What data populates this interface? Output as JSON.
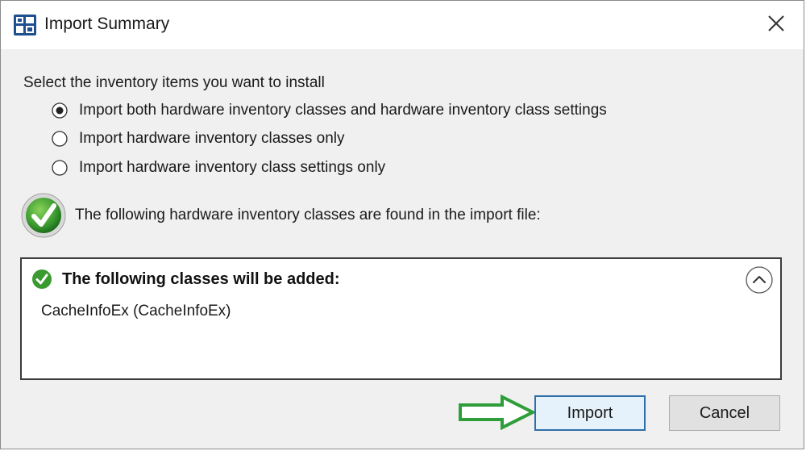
{
  "window": {
    "title": "Import Summary",
    "app_icon": "configuration-manager-icon",
    "close_icon": "close-icon"
  },
  "instruction": "Select the inventory items you want to install",
  "options": [
    {
      "label": "Import both hardware inventory classes and hardware inventory class settings",
      "selected": true
    },
    {
      "label": "Import hardware inventory classes only",
      "selected": false
    },
    {
      "label": "Import hardware inventory class settings only",
      "selected": false
    }
  ],
  "status": {
    "icon": "success-check-icon",
    "message": "The following hardware inventory classes are found in the import file:"
  },
  "results": {
    "header_icon": "small-check-icon",
    "header": "The following classes will be added:",
    "collapse_icon": "chevron-up-icon",
    "items": [
      "CacheInfoEx (CacheInfoEx)"
    ]
  },
  "annotation": {
    "arrow_icon": "green-arrow-icon",
    "color": "#2e9e3a"
  },
  "buttons": {
    "import_label": "Import",
    "cancel_label": "Cancel"
  },
  "colors": {
    "accent": "#2f6fa7",
    "check_green": "#3a9a2f",
    "dialog_bg": "#f0f0f0"
  }
}
